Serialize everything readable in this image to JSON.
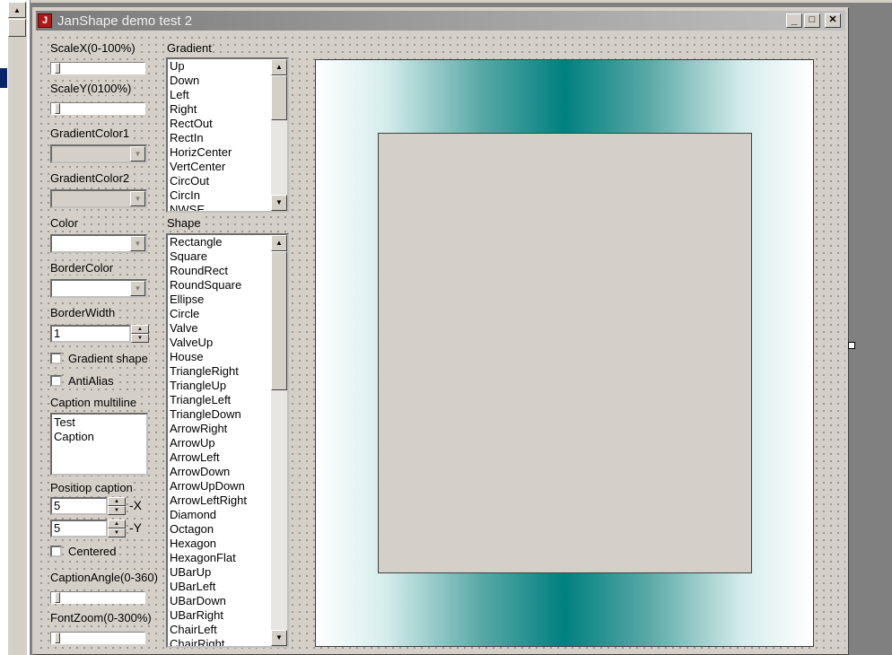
{
  "window": {
    "title": "JanShape demo test 2",
    "minimize": "_",
    "maximize": "□",
    "close": "✕"
  },
  "labels": {
    "scalex": "ScaleX(0-100%)",
    "scaley": "ScaleY(0100%)",
    "gradient_color1": "GradientColor1",
    "gradient_color2": "GradientColor2",
    "color": "Color",
    "border_color": "BorderColor",
    "border_width": "BorderWidth",
    "gradient_shape": "Gradient shape",
    "antialias": "AntiAlias",
    "caption_multiline": "Caption multiline",
    "position_caption": "Positiop caption",
    "x_suffix": "-X",
    "y_suffix": "-Y",
    "centered": "Centered",
    "caption_angle": "CaptionAngle(0-360)",
    "font_zoom": "FontZoom(0-300%)",
    "gradient": "Gradient",
    "shape": "Shape"
  },
  "values": {
    "border_width": "1",
    "caption_line1": "Test",
    "caption_line2": "Caption",
    "pos_x": "5",
    "pos_y": "5",
    "gradient_shape_checked": false,
    "antialias_checked": false,
    "centered_checked": false,
    "scalex_level": 0,
    "scaley_level": 0,
    "caption_angle_level": 0,
    "font_zoom_level": 0
  },
  "gradient_list": [
    "Up",
    "Down",
    "Left",
    "Right",
    "RectOut",
    "RectIn",
    "HorizCenter",
    "VertCenter",
    "CircOut",
    "CircIn",
    "NWSE"
  ],
  "shape_list": [
    "Rectangle",
    "Square",
    "RoundRect",
    "RoundSquare",
    "Ellipse",
    "Circle",
    "Valve",
    "ValveUp",
    "House",
    "TriangleRight",
    "TriangleUp",
    "TriangleLeft",
    "TriangleDown",
    "ArrowRight",
    "ArrowUp",
    "ArrowLeft",
    "ArrowDown",
    "ArrowUpDown",
    "ArrowLeftRight",
    "Diamond",
    "Octagon",
    "Hexagon",
    "HexagonFlat",
    "UBarUp",
    "UBarLeft",
    "UBarDown",
    "UBarRight",
    "ChairLeft",
    "ChairRight"
  ],
  "icons": {
    "scroll_up": "▲",
    "scroll_down": "▼",
    "combo_arrow": "▼",
    "spin_up": "▲",
    "spin_down": "▼"
  },
  "colors": {
    "gradient_center": "#008080",
    "gradient_edge": "#ffffff",
    "shape_fill": "#d4d0c8"
  }
}
